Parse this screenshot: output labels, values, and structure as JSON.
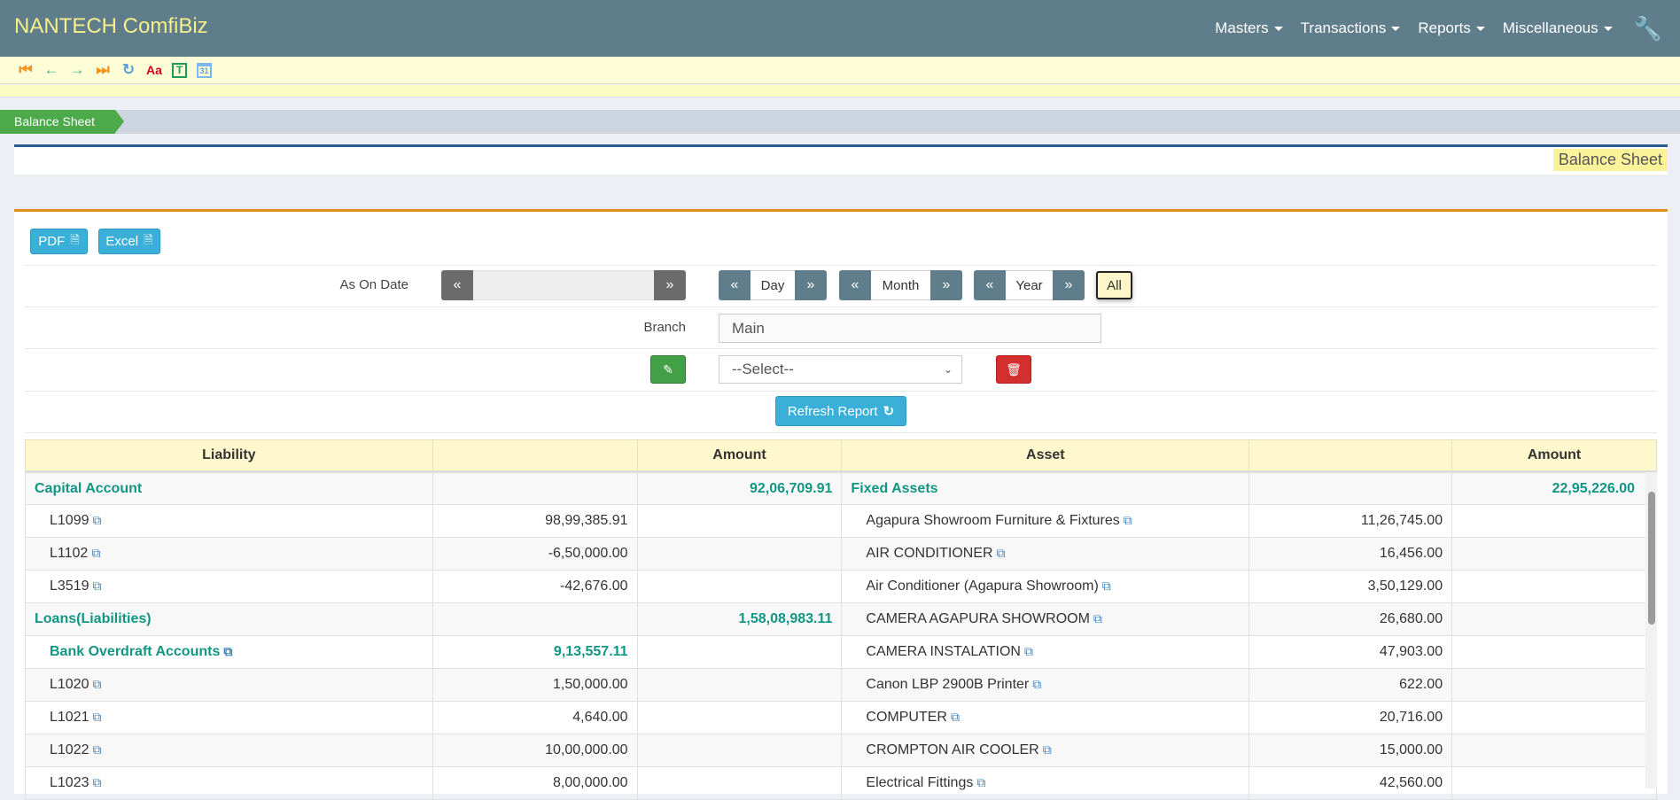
{
  "app": {
    "title": "NANTECH ComfiBiz"
  },
  "nav": [
    {
      "label": "Masters"
    },
    {
      "label": "Transactions"
    },
    {
      "label": "Reports"
    },
    {
      "label": "Miscellaneous"
    }
  ],
  "toolbar": {
    "font_label": "Aa",
    "text_label": "T",
    "calendar_label": "31"
  },
  "breadcrumb": {
    "label": "Balance Sheet"
  },
  "page": {
    "title": "Balance Sheet"
  },
  "export": {
    "pdf": "PDF",
    "excel": "Excel"
  },
  "filters": {
    "as_on_date_label": "As On Date",
    "as_on_date_value": "",
    "day": "Day",
    "month": "Month",
    "year": "Year",
    "all": "All",
    "branch_label": "Branch",
    "branch_value": "Main",
    "select_value": "--Select--",
    "refresh": "Refresh Report"
  },
  "table": {
    "headers": [
      "Liability",
      "",
      "Amount",
      "Asset",
      "",
      "Amount"
    ],
    "rows": [
      {
        "l": "Capital Account",
        "lg": true,
        "lsub": "",
        "lamt": "92,06,709.91",
        "a": "Fixed Assets",
        "ag": true,
        "asub": "",
        "aamt": "22,95,226.00"
      },
      {
        "l": "L1099",
        "lsub": "98,99,385.91",
        "lamt": "",
        "a": "Agapura Showroom Furniture & Fixtures",
        "asub": "11,26,745.00",
        "aamt": ""
      },
      {
        "l": "L1102",
        "lsub": "-6,50,000.00",
        "lamt": "",
        "a": "AIR CONDITIONER",
        "asub": "16,456.00",
        "aamt": ""
      },
      {
        "l": "L3519",
        "lsub": "-42,676.00",
        "lamt": "",
        "a": "Air Conditioner (Agapura Showroom)",
        "asub": "3,50,129.00",
        "aamt": ""
      },
      {
        "l": "Loans(Liabilities)",
        "lg": true,
        "lsub": "",
        "lamt": "1,58,08,983.11",
        "a": "CAMERA AGAPURA SHOWROOM",
        "asub": "26,680.00",
        "aamt": ""
      },
      {
        "l": "Bank Overdraft Accounts",
        "lsg": true,
        "lsub": "9,13,557.11",
        "lamt": "",
        "a": "CAMERA INSTALATION",
        "asub": "47,903.00",
        "aamt": ""
      },
      {
        "l": "L1020",
        "lsub": "1,50,000.00",
        "lamt": "",
        "a": "Canon LBP 2900B Printer",
        "asub": "622.00",
        "aamt": ""
      },
      {
        "l": "L1021",
        "lsub": "4,640.00",
        "lamt": "",
        "a": "COMPUTER",
        "asub": "20,716.00",
        "aamt": ""
      },
      {
        "l": "L1022",
        "lsub": "10,00,000.00",
        "lamt": "",
        "a": "CROMPTON AIR COOLER",
        "asub": "15,000.00",
        "aamt": ""
      },
      {
        "l": "L1023",
        "lsub": "8,00,000.00",
        "lamt": "",
        "a": "Electrical Fittings",
        "asub": "42,560.00",
        "aamt": ""
      }
    ]
  }
}
